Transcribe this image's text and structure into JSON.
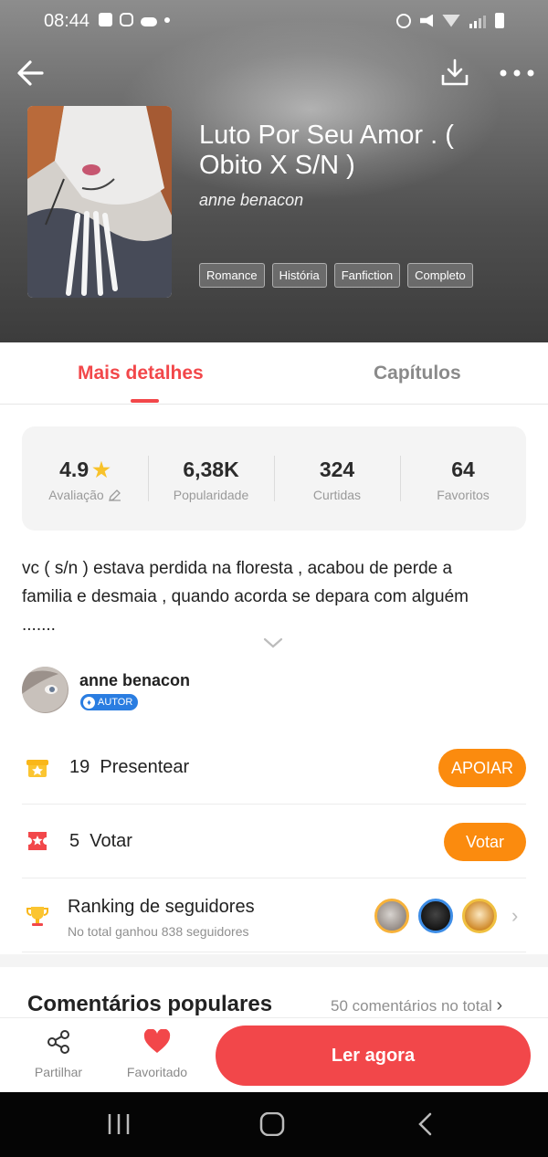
{
  "status_bar": {
    "time": "08:44"
  },
  "header": {
    "title": "Luto Por Seu Amor . ( Obito X S/N )",
    "author": "anne benacon",
    "tags": [
      "Romance",
      "História",
      "Fanfiction",
      "Completo"
    ]
  },
  "tabs": {
    "details": "Mais detalhes",
    "chapters": "Capítulos"
  },
  "stats": {
    "rating": {
      "value": "4.9",
      "label": "Avaliação"
    },
    "popularity": {
      "value": "6,38K",
      "label": "Popularidade"
    },
    "likes": {
      "value": "324",
      "label": "Curtidas"
    },
    "favorites": {
      "value": "64",
      "label": "Favoritos"
    }
  },
  "description": "vc ( s/n ) estava perdida na floresta , acabou de perde a familia e desmaia , quando acorda se depara com alguém .......",
  "author": {
    "name": "anne benacon",
    "badge": "AUTOR"
  },
  "gift": {
    "count": "19",
    "label": "Presentear",
    "button": "APOIAR"
  },
  "vote": {
    "count": "5",
    "label": "Votar",
    "button": "Votar"
  },
  "ranking": {
    "title": "Ranking de seguidores",
    "subtitle": "No total ganhou 838 seguidores"
  },
  "comments": {
    "title": "Comentários populares",
    "total": "50 comentários no total"
  },
  "bottom_bar": {
    "share": "Partilhar",
    "favorite": "Favoritado",
    "read": "Ler agora"
  },
  "colors": {
    "accent": "#f2474a",
    "orange": "#fb8b0e",
    "badge_blue": "#2a7de1"
  },
  "icons": [
    "back-icon",
    "download-icon",
    "more-icon",
    "star-icon",
    "edit-icon",
    "chevron-down-icon",
    "gift-icon",
    "ticket-icon",
    "trophy-icon",
    "chevron-right-icon",
    "share-icon",
    "heart-icon"
  ]
}
